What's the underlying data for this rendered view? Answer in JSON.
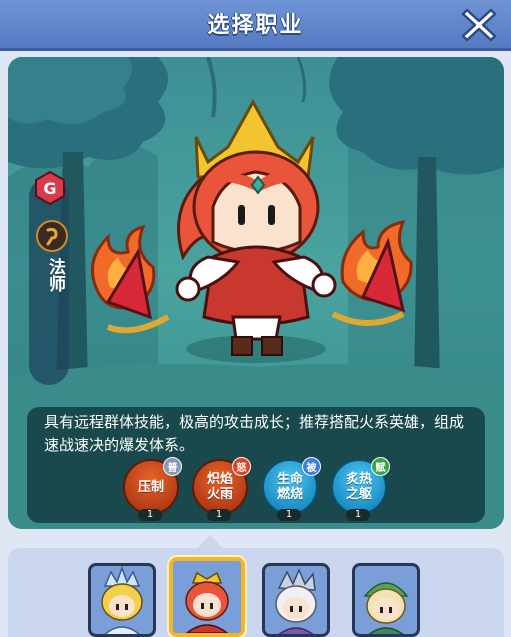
{
  "header": {
    "title": "选择职业",
    "close_icon": "close-x-icon"
  },
  "hero": {
    "grade_letter": "G",
    "class_icon": "mage-staff-icon",
    "class_name": "法师",
    "description": "具有远程群体技能，极高的攻击成长；推荐搭配火系英雄，组成速战速决的爆发体系。"
  },
  "skills": [
    {
      "name": "压制",
      "tag": "普",
      "level": "1",
      "tag_color": "#8a98b8",
      "style": "fire"
    },
    {
      "name": "炽焰火雨",
      "tag": "怒",
      "level": "1",
      "tag_color": "#d9452a",
      "style": "fire"
    },
    {
      "name": "生命燃烧",
      "tag": "被",
      "level": "1",
      "tag_color": "#3d7fd6",
      "style": "aqua"
    },
    {
      "name": "炙热之躯",
      "tag": "赋",
      "level": "1",
      "tag_color": "#3aa34a",
      "style": "aqua"
    }
  ],
  "heroes": [
    {
      "portrait": "blonde-paladin-portrait"
    },
    {
      "portrait": "red-hair-mage-portrait"
    },
    {
      "portrait": "white-hair-warrior-portrait"
    },
    {
      "portrait": "green-cap-ranger-portrait"
    }
  ],
  "colors": {
    "topbar": "#5f86cc",
    "panel": "#3f9695",
    "selected_frame": "#f2b52b"
  }
}
